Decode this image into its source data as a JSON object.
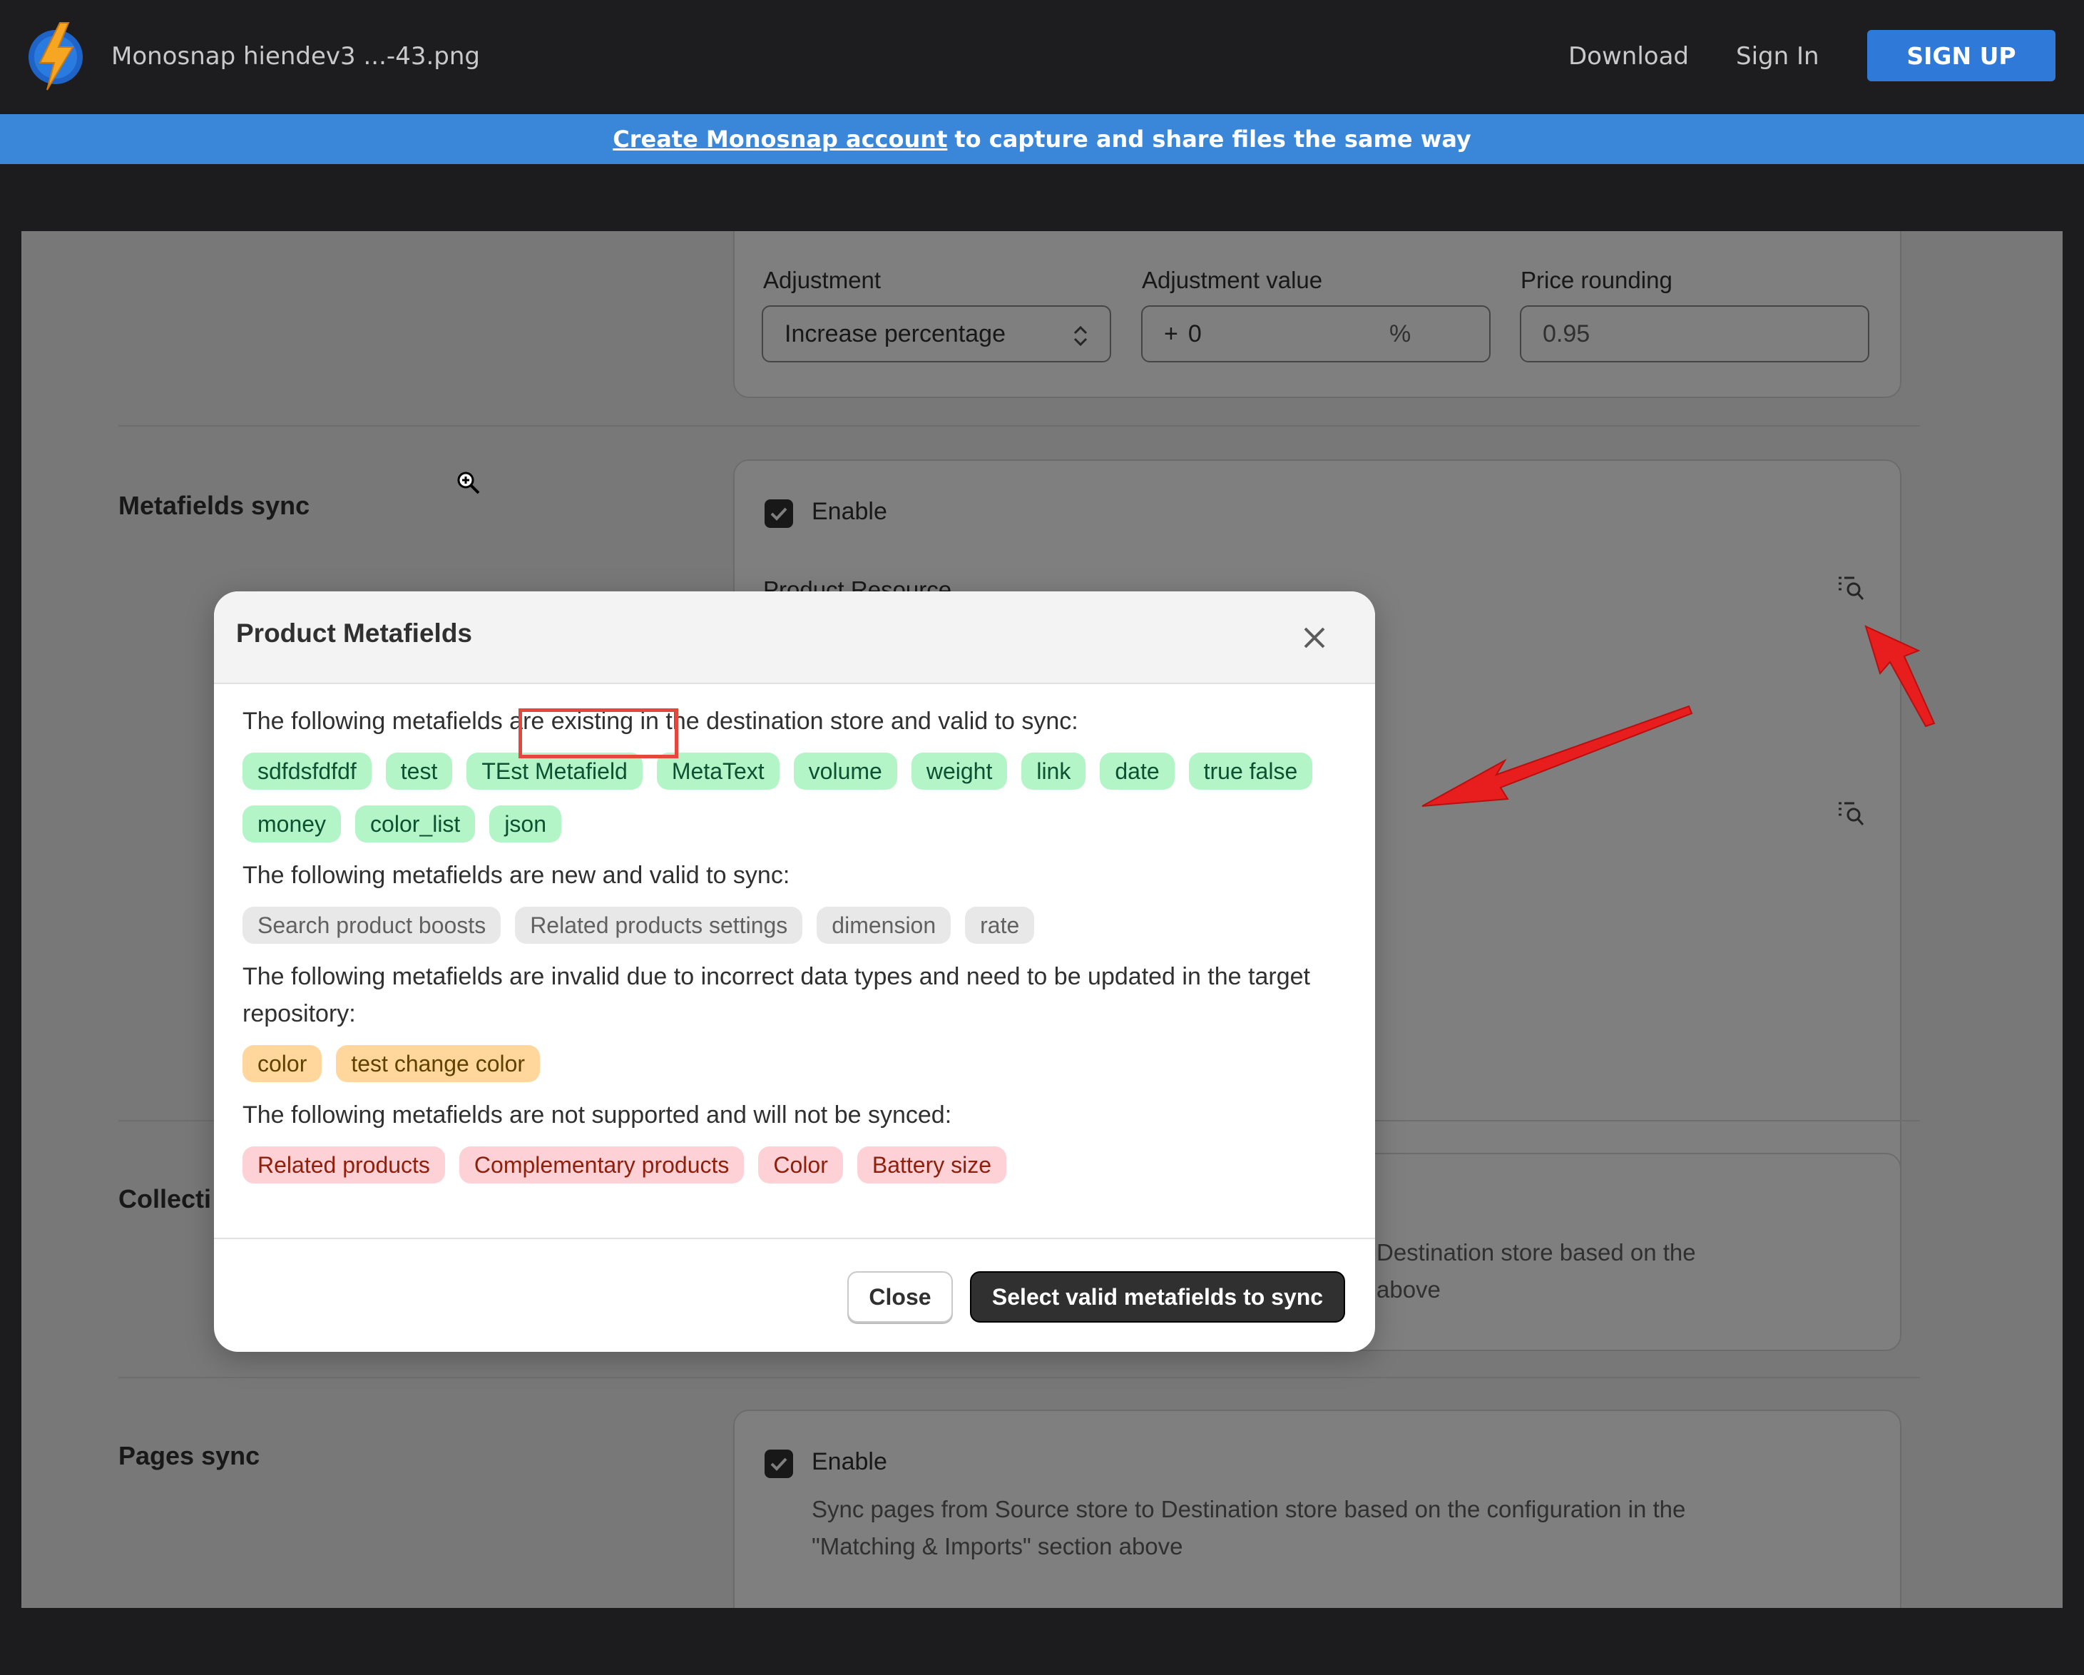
{
  "topbar": {
    "file_title": "Monosnap hiendev3 ...-43.png",
    "download_label": "Download",
    "signin_label": "Sign In",
    "signup_label": "SIGN UP"
  },
  "banner": {
    "link_text": "Create Monosnap account",
    "rest_text": "to capture and share files the same way"
  },
  "pricing": {
    "adjustment_label": "Adjustment",
    "adjustment_value": "Increase percentage",
    "adjustment_value_label": "Adjustment value",
    "adjustment_prefix": "+",
    "adjustment_amount": "0",
    "adjustment_suffix": "%",
    "price_rounding_label": "Price rounding",
    "price_rounding_value": "0.95"
  },
  "metafields_sync": {
    "section_label": "Metafields sync",
    "enable_label": "Enable",
    "product_resource_label": "Product Resource"
  },
  "collections_sync": {
    "section_label": "Collecti",
    "desc_line1": "Destination store based on the",
    "desc_line2": "above"
  },
  "pages_sync": {
    "section_label": "Pages sync",
    "enable_label": "Enable",
    "desc_line1": "Sync pages from Source store to Destination store based on the configuration in the",
    "desc_line2": "\"Matching & Imports\" section above"
  },
  "modal": {
    "title": "Product Metafields",
    "existing_desc": "The following metafields are existing in the destination store and valid to sync:",
    "existing_tags": [
      "sdfdsfdfdf",
      "test",
      "TEst Metafield",
      "MetaText",
      "volume",
      "weight",
      "link",
      "date",
      "true false",
      "money",
      "color_list",
      "json"
    ],
    "new_desc": "The following metafields are new and valid to sync:",
    "new_tags": [
      "Search product boosts",
      "Related products settings",
      "dimension",
      "rate"
    ],
    "invalid_desc": "The following metafields are invalid due to incorrect data types and need to be updated in the target repository:",
    "invalid_tags": [
      "color",
      "test change color"
    ],
    "unsupported_desc": "The following metafields are not supported and will not be synced:",
    "unsupported_tags": [
      "Related products",
      "Complementary products",
      "Color",
      "Battery size"
    ],
    "close_label": "Close",
    "primary_label": "Select valid metafields to sync"
  },
  "colors": {
    "annotation_red": "#e5473d",
    "brand_blue": "#2f7ad8"
  }
}
